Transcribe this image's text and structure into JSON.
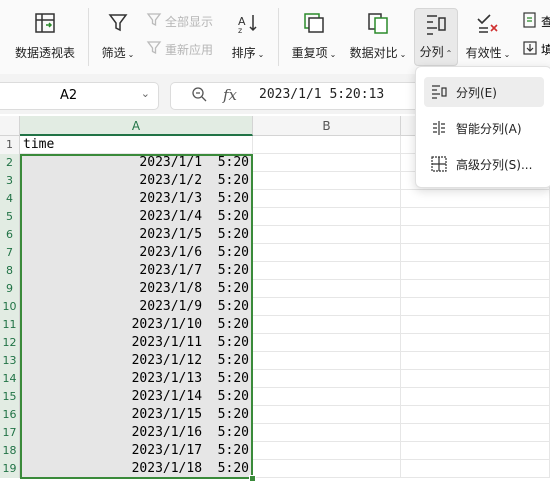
{
  "ribbon": {
    "pivot_label": "数据透视表",
    "filter_label": "筛选",
    "show_all_label": "全部显示",
    "reapply_label": "重新应用",
    "sort_label": "排序",
    "duplicates_label": "重复项",
    "compare_label": "数据对比",
    "split_label": "分列",
    "validity_label": "有效性",
    "cut_off_top": "查",
    "cut_off_bottom": "填"
  },
  "formula_bar": {
    "name_box": "A2",
    "fx": "fx",
    "value": "2023/1/1  5:20:13"
  },
  "columns": [
    "A",
    "B"
  ],
  "rows": [
    {
      "n": "1",
      "a": "time"
    },
    {
      "n": "2",
      "a": "2023/1/1  5:20"
    },
    {
      "n": "3",
      "a": "2023/1/2  5:20"
    },
    {
      "n": "4",
      "a": "2023/1/3  5:20"
    },
    {
      "n": "5",
      "a": "2023/1/4  5:20"
    },
    {
      "n": "6",
      "a": "2023/1/5  5:20"
    },
    {
      "n": "7",
      "a": "2023/1/6  5:20"
    },
    {
      "n": "8",
      "a": "2023/1/7  5:20"
    },
    {
      "n": "9",
      "a": "2023/1/8  5:20"
    },
    {
      "n": "10",
      "a": "2023/1/9  5:20"
    },
    {
      "n": "11",
      "a": "2023/1/10  5:20"
    },
    {
      "n": "12",
      "a": "2023/1/11  5:20"
    },
    {
      "n": "13",
      "a": "2023/1/12  5:20"
    },
    {
      "n": "14",
      "a": "2023/1/13  5:20"
    },
    {
      "n": "15",
      "a": "2023/1/14  5:20"
    },
    {
      "n": "16",
      "a": "2023/1/15  5:20"
    },
    {
      "n": "17",
      "a": "2023/1/16  5:20"
    },
    {
      "n": "18",
      "a": "2023/1/17  5:20"
    },
    {
      "n": "19",
      "a": "2023/1/18  5:20"
    }
  ],
  "split_menu": {
    "items": [
      {
        "label": "分列(E)",
        "icon": "split-column-icon"
      },
      {
        "label": "智能分列(A)",
        "icon": "smart-split-icon"
      },
      {
        "label": "高级分列(S)...",
        "icon": "advanced-split-icon"
      }
    ]
  },
  "colors": {
    "selection": "#3a8a3a",
    "selected_fill": "#e6e6e6",
    "header_green": "#217346"
  }
}
